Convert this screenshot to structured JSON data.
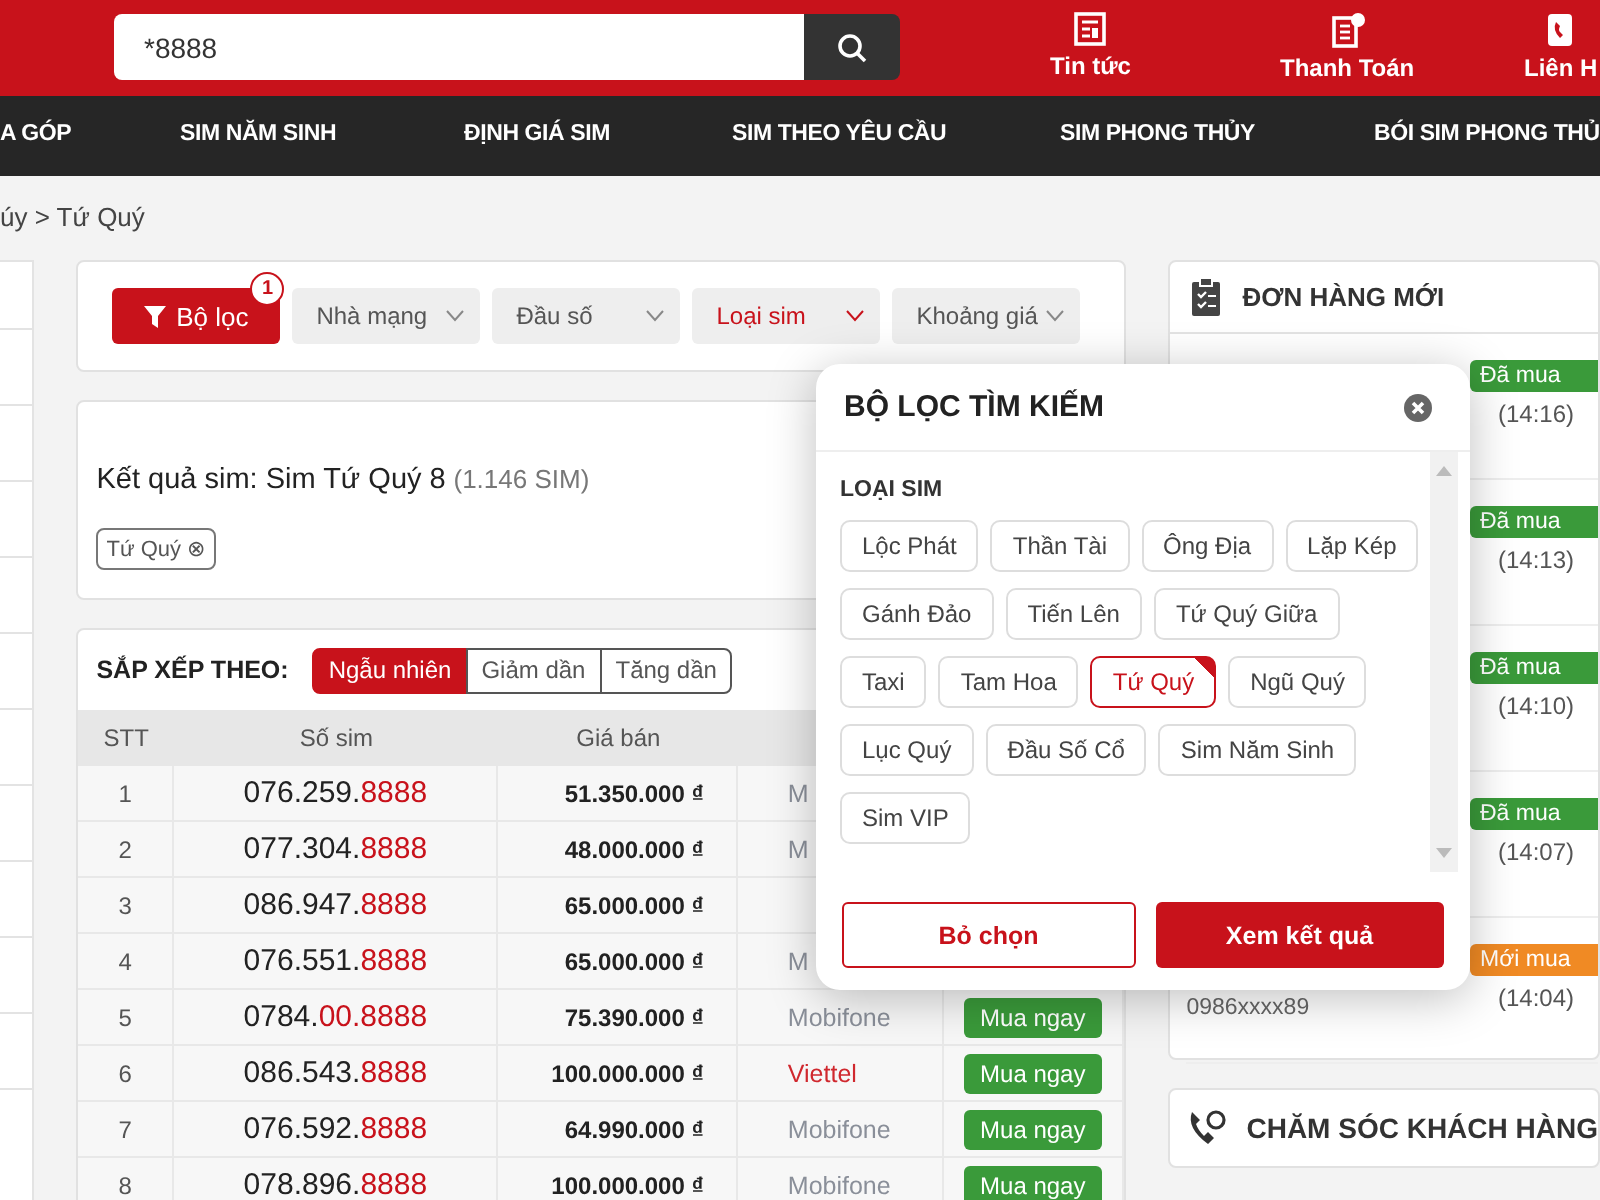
{
  "header": {
    "search": {
      "value": "*8888"
    },
    "links": [
      {
        "label": "Tin tức",
        "kind": "news"
      },
      {
        "label": "Thanh Toán",
        "kind": "pay"
      },
      {
        "label": "Liên H",
        "kind": "contact"
      }
    ]
  },
  "nav": [
    "A GÓP",
    "SIM NĂM SINH",
    "ĐỊNH GIÁ SIM",
    "SIM THEO YÊU CẦU",
    "SIM PHONG THỦY",
    "BÓI SIM PHONG THỦ"
  ],
  "breadcrumb": "úy > Tứ Quý",
  "filters": {
    "button": "Bộ lọc",
    "count": "1",
    "dropdowns": [
      {
        "label": "Nhà mạng",
        "selected": false
      },
      {
        "label": "Đầu số",
        "selected": false
      },
      {
        "label": "Loại sim",
        "selected": true
      },
      {
        "label": "Khoảng giá",
        "selected": false
      }
    ]
  },
  "results": {
    "title": "Kết quả sim: Sim Tứ Quý 8",
    "count": "(1.146 SIM)",
    "tags": [
      "Tứ Quý ⊗"
    ]
  },
  "sort": {
    "label": "SẮP XẾP THEO:",
    "options": [
      {
        "label": "Ngẫu nhiên",
        "selected": true
      },
      {
        "label": "Giảm dần",
        "selected": false
      },
      {
        "label": "Tăng dần",
        "selected": false
      }
    ]
  },
  "table": {
    "columns": [
      "STT",
      "Số sim",
      "Giá bán"
    ],
    "rows": [
      {
        "stt": "1",
        "prefix": "076.259.",
        "tail": "8888",
        "price": "51.350.000 ₫",
        "carrier": "M",
        "color": "#8a8f99"
      },
      {
        "stt": "2",
        "prefix": "077.304.",
        "tail": "8888",
        "price": "48.000.000 ₫",
        "carrier": "M",
        "color": "#8a8f99"
      },
      {
        "stt": "3",
        "prefix": "086.947.",
        "tail": "8888",
        "price": "65.000.000 ₫"
      },
      {
        "stt": "4",
        "prefix": "076.551.",
        "tail": "8888",
        "price": "65.000.000 ₫",
        "carrier": "M",
        "color": "#8a8f99"
      },
      {
        "stt": "5",
        "prefix": "0784.",
        "tail": "00.8888",
        "price": "75.390.000 ₫",
        "carrier": "Mobifone",
        "color": "#8a8f99",
        "action": "Mua ngay"
      },
      {
        "stt": "6",
        "prefix": "086.543.",
        "tail": "8888",
        "price": "100.000.000 ₫",
        "carrier": "Viettel",
        "color": "#d0282e",
        "action": "Mua ngay"
      },
      {
        "stt": "7",
        "prefix": "076.592.",
        "tail": "8888",
        "price": "64.990.000 ₫",
        "carrier": "Mobifone",
        "color": "#8a8f99",
        "action": "Mua ngay"
      },
      {
        "stt": "8",
        "prefix": "078.896.",
        "tail": "8888",
        "price": "100.000.000 ₫",
        "carrier": "Mobifone",
        "color": "#8a8f99",
        "action": "Mua ngay"
      }
    ]
  },
  "orders": {
    "title": "ĐƠN HÀNG MỚI",
    "items": [
      {
        "status": "Đã mua",
        "kind": "bought",
        "time": "(14:16)"
      },
      {
        "status": "Đã mua",
        "kind": "bought",
        "time": "(14:13)"
      },
      {
        "status": "Đã mua",
        "kind": "bought",
        "time": "(14:10)"
      },
      {
        "status": "Đã mua",
        "kind": "bought",
        "time": "(14:07)"
      },
      {
        "status": "Mới mua",
        "kind": "new",
        "time": "(14:04)",
        "phone": "0986xxxx89"
      }
    ]
  },
  "support": {
    "title": "CHĂM SÓC KHÁCH HÀNG"
  },
  "popup": {
    "title": "BỘ LỌC TÌM KIẾM",
    "section": "LOẠI SIM",
    "chips": [
      {
        "label": "Lộc Phát",
        "selected": false
      },
      {
        "label": "Thần Tài",
        "selected": false
      },
      {
        "label": "Ông Địa",
        "selected": false
      },
      {
        "label": "Lặp Kép",
        "selected": false
      },
      {
        "label": "Gánh Đảo",
        "selected": false
      },
      {
        "label": "Tiến Lên",
        "selected": false
      },
      {
        "label": "Tứ Quý Giữa",
        "selected": false
      },
      {
        "label": "Taxi",
        "selected": false
      },
      {
        "label": "Tam Hoa",
        "selected": false
      },
      {
        "label": "Tứ Quý",
        "selected": true
      },
      {
        "label": "Ngũ Quý",
        "selected": false
      },
      {
        "label": "Lục Quý",
        "selected": false
      },
      {
        "label": "Đầu Số Cổ",
        "selected": false
      },
      {
        "label": "Sim Năm Sinh",
        "selected": false
      },
      {
        "label": "Sim VIP",
        "selected": false
      }
    ],
    "clear": "Bỏ chọn",
    "apply": "Xem kết quả"
  }
}
